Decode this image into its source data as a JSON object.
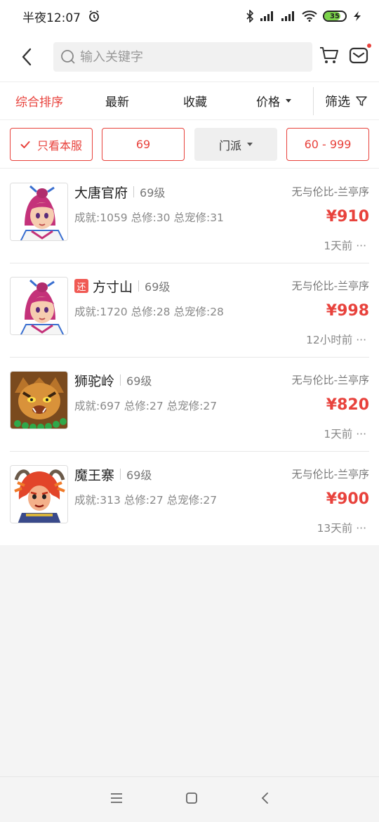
{
  "status_bar": {
    "time": "半夜12:07",
    "battery": "35"
  },
  "header": {
    "search_placeholder": "输入关键字"
  },
  "sort_tabs": [
    {
      "label": "综合排序",
      "active": true
    },
    {
      "label": "最新",
      "active": false
    },
    {
      "label": "收藏",
      "active": false
    },
    {
      "label": "价格",
      "active": false,
      "dropdown": true
    },
    {
      "label": "筛选",
      "active": false,
      "icon": "filter-icon"
    }
  ],
  "filters": {
    "only_server": "只看本服",
    "level": "69",
    "school": "门派",
    "price_range": "60 - 999"
  },
  "items": [
    {
      "name": "大唐官府",
      "level": "69级",
      "stats": "成就:1059 总修:30 总宠修:31",
      "server": "无与伦比-兰亭序",
      "price": "¥910",
      "time": "1天前 ···",
      "badge": "",
      "avatar": "avatar-girl"
    },
    {
      "name": "方寸山",
      "level": "69级",
      "stats": "成就:1720 总修:28 总宠修:28",
      "server": "无与伦比-兰亭序",
      "price": "¥998",
      "time": "12小时前 ···",
      "badge": "还",
      "avatar": "avatar-girl"
    },
    {
      "name": "狮驼岭",
      "level": "69级",
      "stats": "成就:697 总修:27 总宠修:27",
      "server": "无与伦比-兰亭序",
      "price": "¥820",
      "time": "1天前 ···",
      "badge": "",
      "avatar": "avatar-lion"
    },
    {
      "name": "魔王寨",
      "level": "69级",
      "stats": "成就:313 总修:27 总宠修:27",
      "server": "无与伦比-兰亭序",
      "price": "¥900",
      "time": "13天前 ···",
      "badge": "",
      "avatar": "avatar-demon"
    }
  ],
  "colors": {
    "accent": "#e8423c",
    "badge": "#f05a54"
  }
}
